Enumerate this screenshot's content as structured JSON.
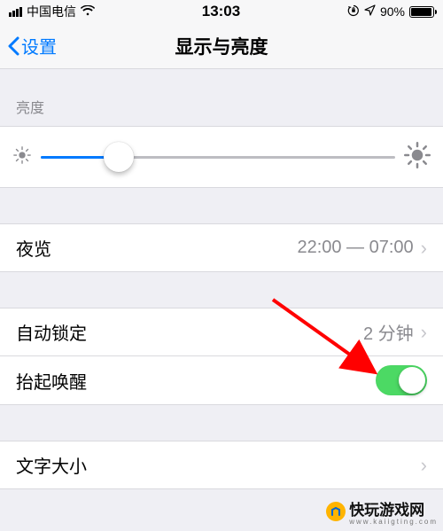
{
  "status": {
    "carrier": "中国电信",
    "time": "13:03",
    "battery_pct": "90%"
  },
  "nav": {
    "back_label": "设置",
    "title": "显示与亮度"
  },
  "brightness": {
    "header": "亮度"
  },
  "rows": {
    "night_shift": {
      "label": "夜览",
      "value": "22:00 — 07:00"
    },
    "auto_lock": {
      "label": "自动锁定",
      "value": "2 分钟"
    },
    "raise_wake": {
      "label": "抬起唤醒"
    },
    "text_size": {
      "label": "文字大小"
    }
  },
  "watermark": {
    "text": "快玩游戏网",
    "sub": "www.kaiigting.com"
  }
}
